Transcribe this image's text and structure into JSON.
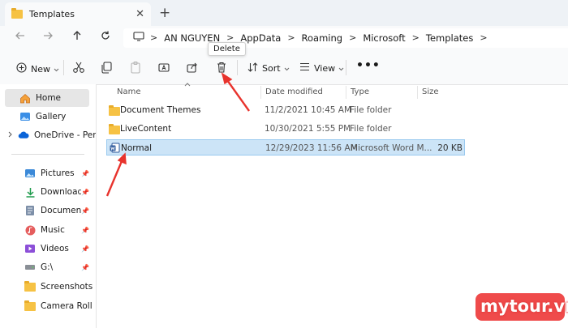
{
  "window": {
    "tab_title": "Templates",
    "tab_close": "✕",
    "new_tab": "+"
  },
  "address": {
    "crumbs": [
      "AN NGUYEN",
      "AppData",
      "Roaming",
      "Microsoft",
      "Templates"
    ],
    "separator": ">"
  },
  "toolbar": {
    "new_label": "New",
    "sort_label": "Sort",
    "view_label": "View",
    "more_label": "•••",
    "delete_tooltip": "Delete"
  },
  "columns": {
    "name": "Name",
    "date": "Date modified",
    "type": "Type",
    "size": "Size"
  },
  "files": [
    {
      "name": "Document Themes",
      "date": "11/2/2021 10:45 AM",
      "type": "File folder",
      "size": "",
      "icon": "folder-icon"
    },
    {
      "name": "LiveContent",
      "date": "10/30/2021 5:55 PM",
      "type": "File folder",
      "size": "",
      "icon": "folder-icon"
    },
    {
      "name": "Normal",
      "date": "12/29/2023 11:56 AM",
      "type": "Microsoft Word M...",
      "size": "20 KB",
      "icon": "word-document-icon"
    }
  ],
  "sidebar": {
    "items": [
      {
        "label": "Home",
        "icon": "home-icon"
      },
      {
        "label": "Gallery",
        "icon": "gallery-icon"
      },
      {
        "label": "OneDrive - Perso",
        "icon": "cloud-icon"
      },
      {
        "label": "Pictures",
        "icon": "pictures-icon"
      },
      {
        "label": "Downloads",
        "icon": "downloads-icon"
      },
      {
        "label": "Documents",
        "icon": "documents-icon"
      },
      {
        "label": "Music",
        "icon": "music-icon"
      },
      {
        "label": "Videos",
        "icon": "videos-icon"
      },
      {
        "label": "G:\\",
        "icon": "drive-icon"
      },
      {
        "label": "Screenshots",
        "icon": "folder-icon"
      },
      {
        "label": "Camera Roll",
        "icon": "folder-icon"
      }
    ]
  },
  "watermark": "mytour.vn",
  "colors": {
    "selection": "#cce4f7",
    "accent": "#0067c0",
    "arrow": "#e8332d"
  }
}
